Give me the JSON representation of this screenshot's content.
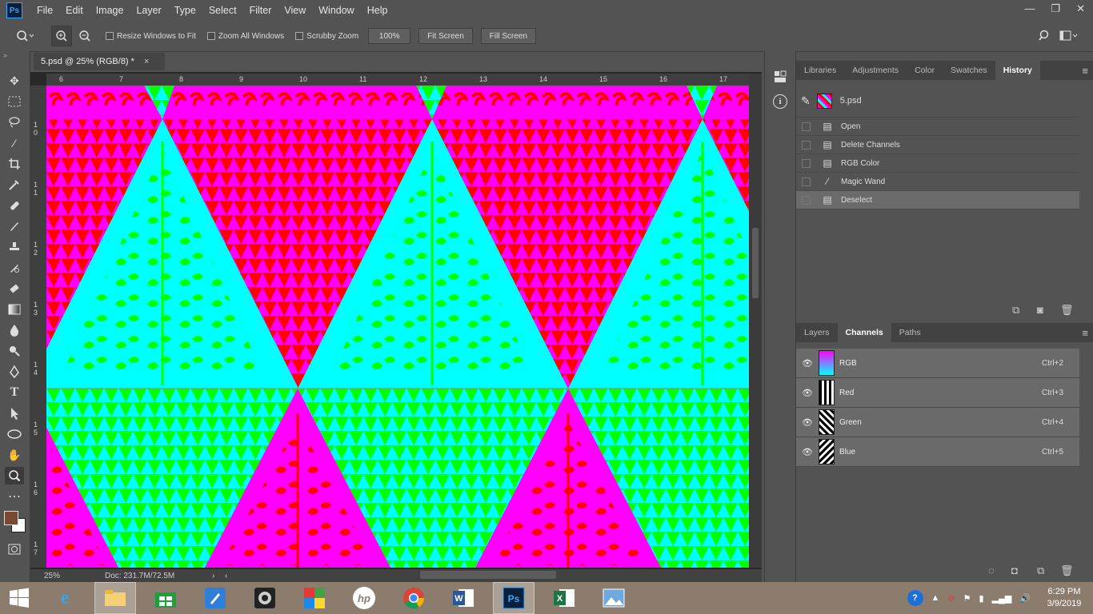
{
  "app": {
    "logo": "Ps"
  },
  "menu": [
    "File",
    "Edit",
    "Image",
    "Layer",
    "Type",
    "Select",
    "Filter",
    "View",
    "Window",
    "Help"
  ],
  "window_controls": {
    "minimize": "—",
    "restore": "❐",
    "close": "✕"
  },
  "options": {
    "resize_windows": "Resize Windows to Fit",
    "zoom_all": "Zoom All Windows",
    "scrubby": "Scrubby Zoom",
    "zoom_level": "100%",
    "fit_screen": "Fit Screen",
    "fill_screen": "Fill Screen"
  },
  "document": {
    "tab_title": "5.psd @ 25% (RGB/8) *",
    "close": "×"
  },
  "ruler_top": [
    "6",
    "7",
    "8",
    "9",
    "10",
    "11",
    "12",
    "13",
    "14",
    "15",
    "16",
    "17"
  ],
  "ruler_left": [
    "1 0",
    "1 1",
    "1 2",
    "1 3",
    "1 4",
    "1 5",
    "1 6",
    "1 7"
  ],
  "status": {
    "zoom": "25%",
    "doc_size": "Doc: 231.7M/72.5M"
  },
  "history_tabs": [
    "Libraries",
    "Adjustments",
    "Color",
    "Swatches",
    "History"
  ],
  "history": {
    "snapshot": "5.psd",
    "steps": [
      {
        "label": "Open",
        "icon": "document-icon"
      },
      {
        "label": "Delete Channels",
        "icon": "document-icon"
      },
      {
        "label": "RGB Color",
        "icon": "document-icon"
      },
      {
        "label": "Magic Wand",
        "icon": "magic-wand-icon"
      },
      {
        "label": "Deselect",
        "icon": "document-icon"
      }
    ]
  },
  "channel_tabs": [
    "Layers",
    "Channels",
    "Paths"
  ],
  "channels": [
    {
      "name": "RGB",
      "shortcut": "Ctrl+2"
    },
    {
      "name": "Red",
      "shortcut": "Ctrl+3"
    },
    {
      "name": "Green",
      "shortcut": "Ctrl+4"
    },
    {
      "name": "Blue",
      "shortcut": "Ctrl+5"
    }
  ],
  "pattern_colors": {
    "red": "#ff0000",
    "magenta": "#ff00ff",
    "cyan": "#00ffff",
    "green": "#00ff00"
  },
  "clock": {
    "time": "6:29 PM",
    "date": "3/9/2019"
  }
}
